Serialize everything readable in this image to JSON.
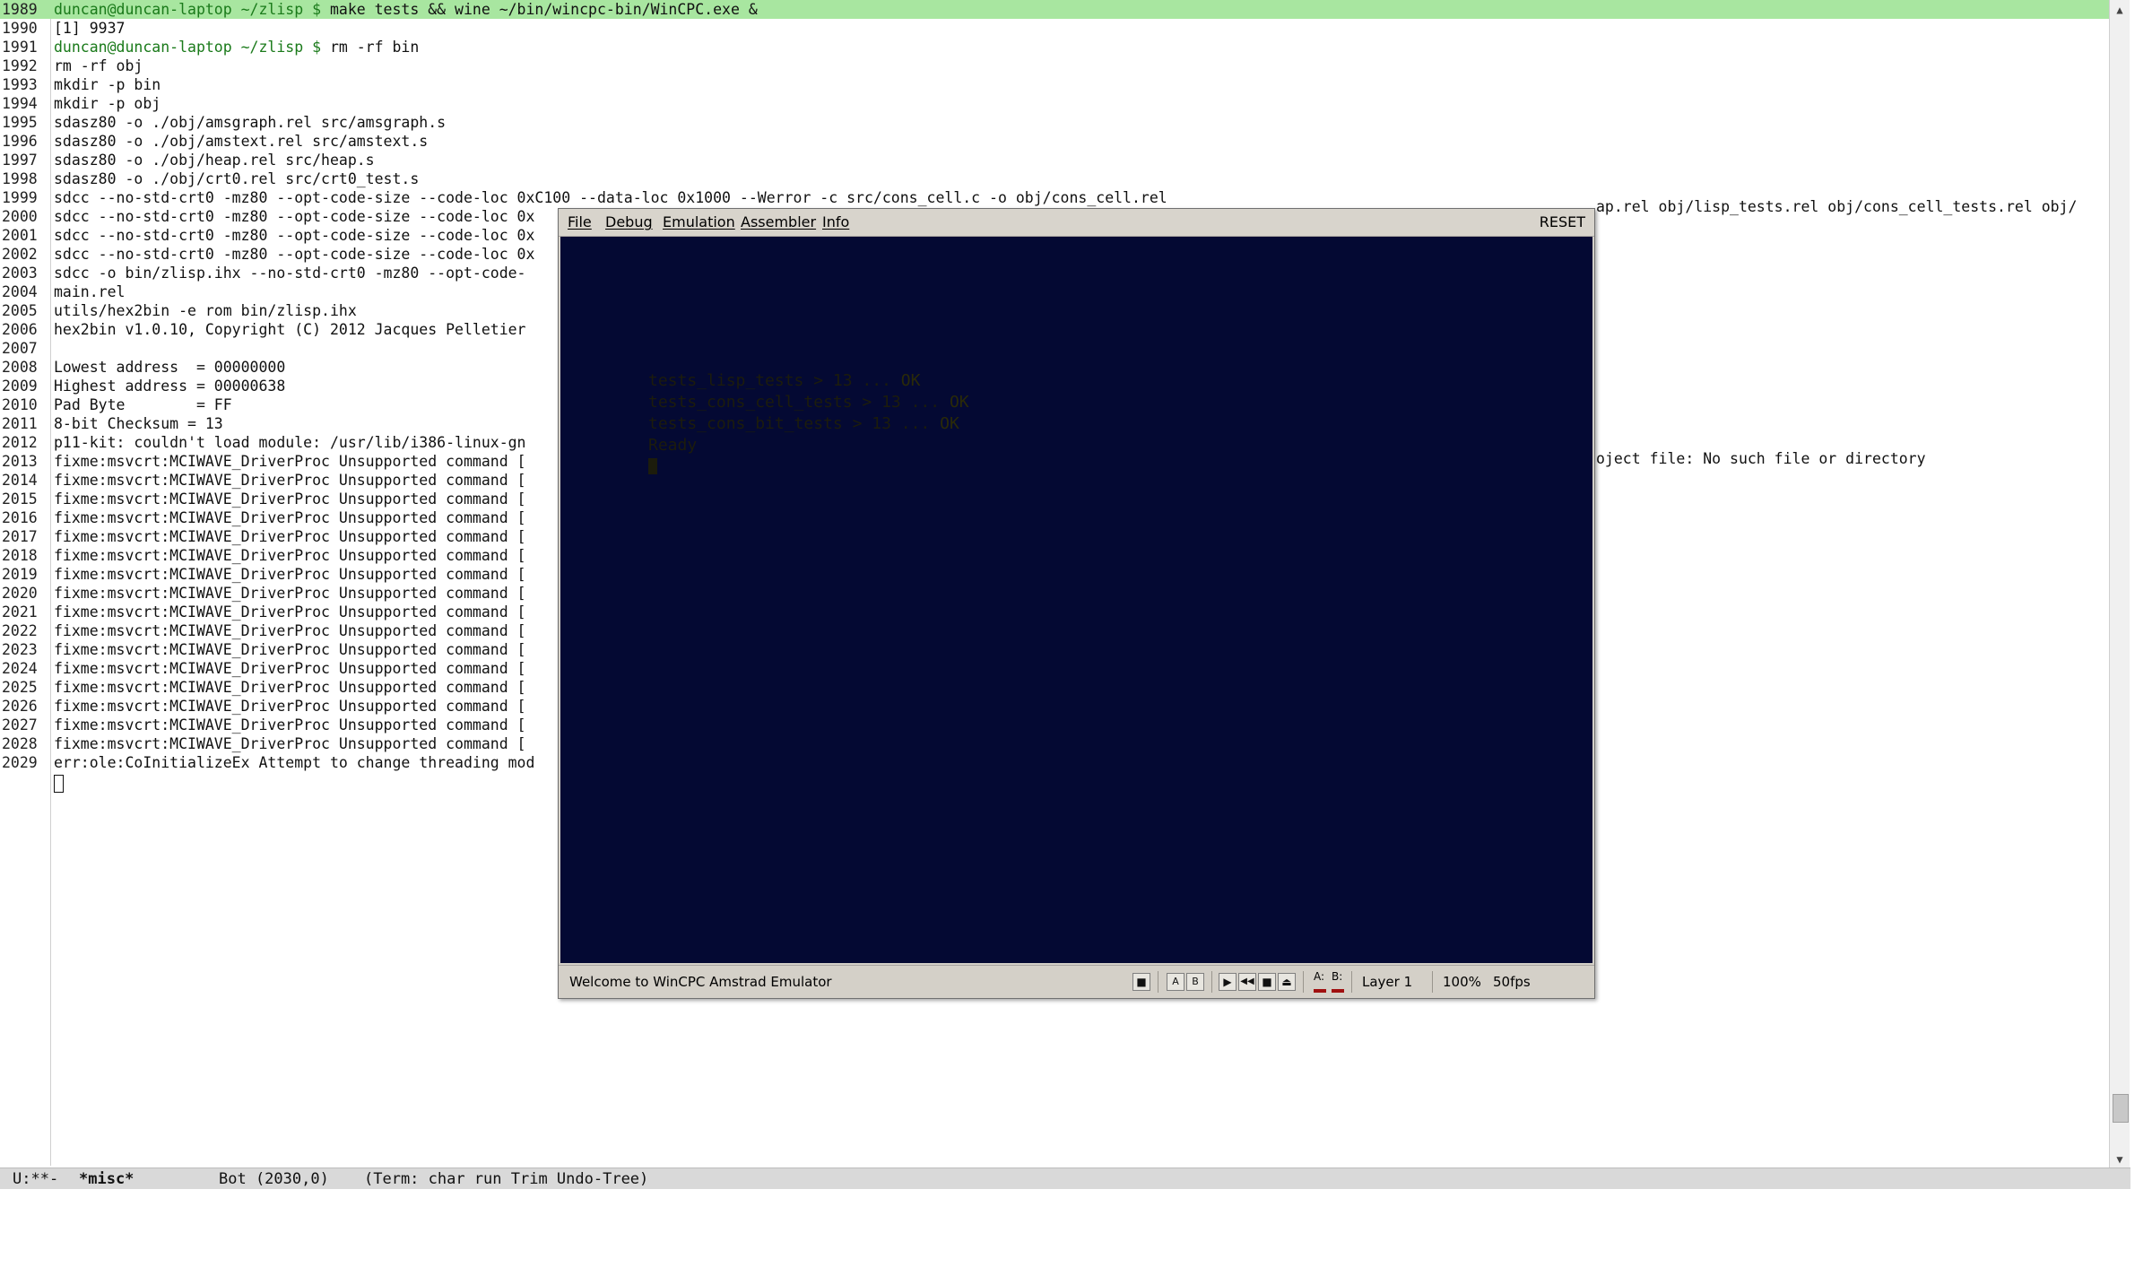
{
  "terminal": {
    "lines": [
      {
        "n": "1989",
        "prompt": "duncan@duncan-laptop ~/zlisp $",
        "text": " make tests && wine ~/bin/wincpc-bin/WinCPC.exe &",
        "highlight": true
      },
      {
        "n": "1990",
        "prompt": "",
        "text": "[1] 9937",
        "highlight": false
      },
      {
        "n": "1991",
        "prompt": "duncan@duncan-laptop ~/zlisp $",
        "text": " rm -rf bin",
        "highlight": false
      },
      {
        "n": "1992",
        "prompt": "",
        "text": "rm -rf obj",
        "highlight": false
      },
      {
        "n": "1993",
        "prompt": "",
        "text": "mkdir -p bin",
        "highlight": false
      },
      {
        "n": "1994",
        "prompt": "",
        "text": "mkdir -p obj",
        "highlight": false
      },
      {
        "n": "1995",
        "prompt": "",
        "text": "sdasz80 -o ./obj/amsgraph.rel src/amsgraph.s",
        "highlight": false
      },
      {
        "n": "1996",
        "prompt": "",
        "text": "sdasz80 -o ./obj/amstext.rel src/amstext.s",
        "highlight": false
      },
      {
        "n": "1997",
        "prompt": "",
        "text": "sdasz80 -o ./obj/heap.rel src/heap.s",
        "highlight": false
      },
      {
        "n": "1998",
        "prompt": "",
        "text": "sdasz80 -o ./obj/crt0.rel src/crt0_test.s",
        "highlight": false
      },
      {
        "n": "1999",
        "prompt": "",
        "text": "sdcc --no-std-crt0 -mz80 --opt-code-size --code-loc 0xC100 --data-loc 0x1000 --Werror -c src/cons_cell.c -o obj/cons_cell.rel",
        "highlight": false
      },
      {
        "n": "2000",
        "prompt": "",
        "text": "sdcc --no-std-crt0 -mz80 --opt-code-size --code-loc 0x",
        "highlight": false
      },
      {
        "n": "2001",
        "prompt": "",
        "text": "sdcc --no-std-crt0 -mz80 --opt-code-size --code-loc 0x",
        "highlight": false
      },
      {
        "n": "2002",
        "prompt": "",
        "text": "sdcc --no-std-crt0 -mz80 --opt-code-size --code-loc 0x",
        "highlight": false
      },
      {
        "n": "2003",
        "prompt": "",
        "text": "sdcc -o bin/zlisp.ihx --no-std-crt0 -mz80 --opt-code-",
        "highlight": false
      },
      {
        "n": "2004",
        "prompt": "",
        "text": "main.rel",
        "highlight": false
      },
      {
        "n": "2005",
        "prompt": "",
        "text": "utils/hex2bin -e rom bin/zlisp.ihx",
        "highlight": false
      },
      {
        "n": "2006",
        "prompt": "",
        "text": "hex2bin v1.0.10, Copyright (C) 2012 Jacques Pelletier",
        "highlight": false
      },
      {
        "n": "2007",
        "prompt": "",
        "text": "",
        "highlight": false
      },
      {
        "n": "2008",
        "prompt": "",
        "text": "Lowest address  = 00000000",
        "highlight": false
      },
      {
        "n": "2009",
        "prompt": "",
        "text": "Highest address = 00000638",
        "highlight": false
      },
      {
        "n": "2010",
        "prompt": "",
        "text": "Pad Byte        = FF",
        "highlight": false
      },
      {
        "n": "2011",
        "prompt": "",
        "text": "8-bit Checksum = 13",
        "highlight": false
      },
      {
        "n": "2012",
        "prompt": "",
        "text": "p11-kit: couldn't load module: /usr/lib/i386-linux-gn",
        "highlight": false
      },
      {
        "n": "2013",
        "prompt": "",
        "text": "fixme:msvcrt:MCIWAVE_DriverProc Unsupported command [",
        "highlight": false
      },
      {
        "n": "2014",
        "prompt": "",
        "text": "fixme:msvcrt:MCIWAVE_DriverProc Unsupported command [",
        "highlight": false
      },
      {
        "n": "2015",
        "prompt": "",
        "text": "fixme:msvcrt:MCIWAVE_DriverProc Unsupported command [",
        "highlight": false
      },
      {
        "n": "2016",
        "prompt": "",
        "text": "fixme:msvcrt:MCIWAVE_DriverProc Unsupported command [",
        "highlight": false
      },
      {
        "n": "2017",
        "prompt": "",
        "text": "fixme:msvcrt:MCIWAVE_DriverProc Unsupported command [",
        "highlight": false
      },
      {
        "n": "2018",
        "prompt": "",
        "text": "fixme:msvcrt:MCIWAVE_DriverProc Unsupported command [",
        "highlight": false
      },
      {
        "n": "2019",
        "prompt": "",
        "text": "fixme:msvcrt:MCIWAVE_DriverProc Unsupported command [",
        "highlight": false
      },
      {
        "n": "2020",
        "prompt": "",
        "text": "fixme:msvcrt:MCIWAVE_DriverProc Unsupported command [",
        "highlight": false
      },
      {
        "n": "2021",
        "prompt": "",
        "text": "fixme:msvcrt:MCIWAVE_DriverProc Unsupported command [",
        "highlight": false
      },
      {
        "n": "2022",
        "prompt": "",
        "text": "fixme:msvcrt:MCIWAVE_DriverProc Unsupported command [",
        "highlight": false
      },
      {
        "n": "2023",
        "prompt": "",
        "text": "fixme:msvcrt:MCIWAVE_DriverProc Unsupported command [",
        "highlight": false
      },
      {
        "n": "2024",
        "prompt": "",
        "text": "fixme:msvcrt:MCIWAVE_DriverProc Unsupported command [",
        "highlight": false
      },
      {
        "n": "2025",
        "prompt": "",
        "text": "fixme:msvcrt:MCIWAVE_DriverProc Unsupported command [",
        "highlight": false
      },
      {
        "n": "2026",
        "prompt": "",
        "text": "fixme:msvcrt:MCIWAVE_DriverProc Unsupported command [",
        "highlight": false
      },
      {
        "n": "2027",
        "prompt": "",
        "text": "fixme:msvcrt:MCIWAVE_DriverProc Unsupported command [",
        "highlight": false
      },
      {
        "n": "2028",
        "prompt": "",
        "text": "fixme:msvcrt:MCIWAVE_DriverProc Unsupported command [",
        "highlight": false
      },
      {
        "n": "2029",
        "prompt": "",
        "text": "err:ole:CoInitializeEx Attempt to change threading mod",
        "highlight": false
      }
    ],
    "overflow_right": {
      "line_2003": "ap.rel obj/lisp_tests.rel obj/cons_cell_tests.rel obj/",
      "line_2012": "oject file: No such file or directory"
    }
  },
  "modeline": {
    "status": "U:**-",
    "buffer": "*misc*",
    "position": "Bot (2030,0)",
    "modes": "(Term: char run Trim Undo-Tree)"
  },
  "wincpc": {
    "menu": [
      "File",
      "Debug",
      "Emulation",
      "Assembler",
      "Info"
    ],
    "reset_label": "RESET",
    "screen_lines": [
      {
        "label": "tests_lisp_tests > 13 ...",
        "result": "OK"
      },
      {
        "label": "tests_cons_cell_tests > 13 ...",
        "result": "OK"
      },
      {
        "label": "tests_cons_bit_tests > 13 ...",
        "result": "OK"
      }
    ],
    "ready_text": "Ready",
    "status": {
      "welcome": "Welcome to WinCPC Amstrad Emulator",
      "drive_a": "A:",
      "drive_b": "B:",
      "layer": "Layer 1",
      "zoom": "100%",
      "fps": "50fps"
    },
    "colors": {
      "screen_bg": "#040933",
      "led": "#a01010"
    }
  }
}
